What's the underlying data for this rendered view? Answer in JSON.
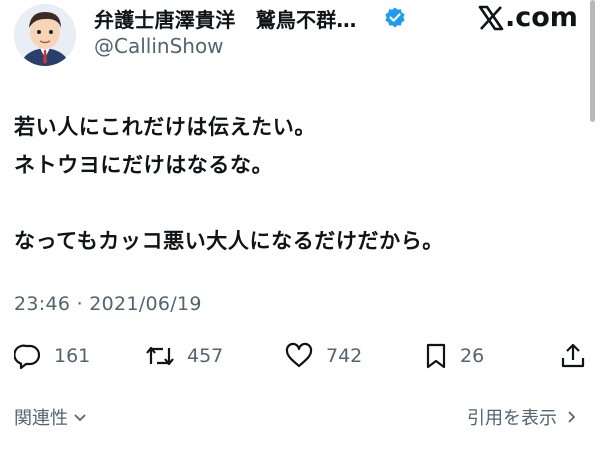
{
  "author": {
    "display_name": "弁護士唐澤貴洋　鷲鳥不群…",
    "handle": "@CallinShow",
    "verified": true,
    "verified_color": "#1d9bf0",
    "avatar_icon": "cartoon-lawyer-avatar"
  },
  "brand": {
    "label": ".com",
    "logo_icon": "x-logo-icon"
  },
  "tweet": {
    "lines": [
      "若い人にこれだけは伝えたい。",
      "ネトウヨにだけはなるな。",
      "なってもカッコ悪い大人になるだけだから。"
    ],
    "timestamp": "23:46 · 2021/06/19"
  },
  "actions": [
    {
      "name": "reply",
      "icon": "reply-icon",
      "count": "161"
    },
    {
      "name": "retweet",
      "icon": "retweet-icon",
      "count": "457"
    },
    {
      "name": "like",
      "icon": "heart-icon",
      "count": "742"
    },
    {
      "name": "bookmark",
      "icon": "bookmark-icon",
      "count": "26"
    },
    {
      "name": "share",
      "icon": "share-icon",
      "count": ""
    }
  ],
  "footer": {
    "related_label": "関連性",
    "quotes_label": "引用を表示"
  },
  "colors": {
    "text": "#0f1419",
    "secondary": "#536471",
    "background": "#ffffff"
  }
}
